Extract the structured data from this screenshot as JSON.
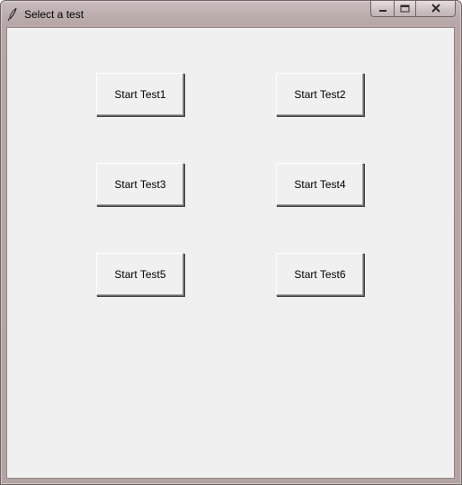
{
  "window": {
    "title": "Select a test",
    "icon": "feather-icon",
    "controls": {
      "minimize_icon": "minimize-icon",
      "maximize_icon": "maximize-icon",
      "close_icon": "close-icon"
    }
  },
  "buttons": [
    {
      "label": "Start Test1"
    },
    {
      "label": "Start Test2"
    },
    {
      "label": "Start Test3"
    },
    {
      "label": "Start Test4"
    },
    {
      "label": "Start Test5"
    },
    {
      "label": "Start Test6"
    }
  ],
  "colors": {
    "client_background": "#f0f0f0",
    "titlebar": "#b7a7a7",
    "text": "#000000"
  }
}
